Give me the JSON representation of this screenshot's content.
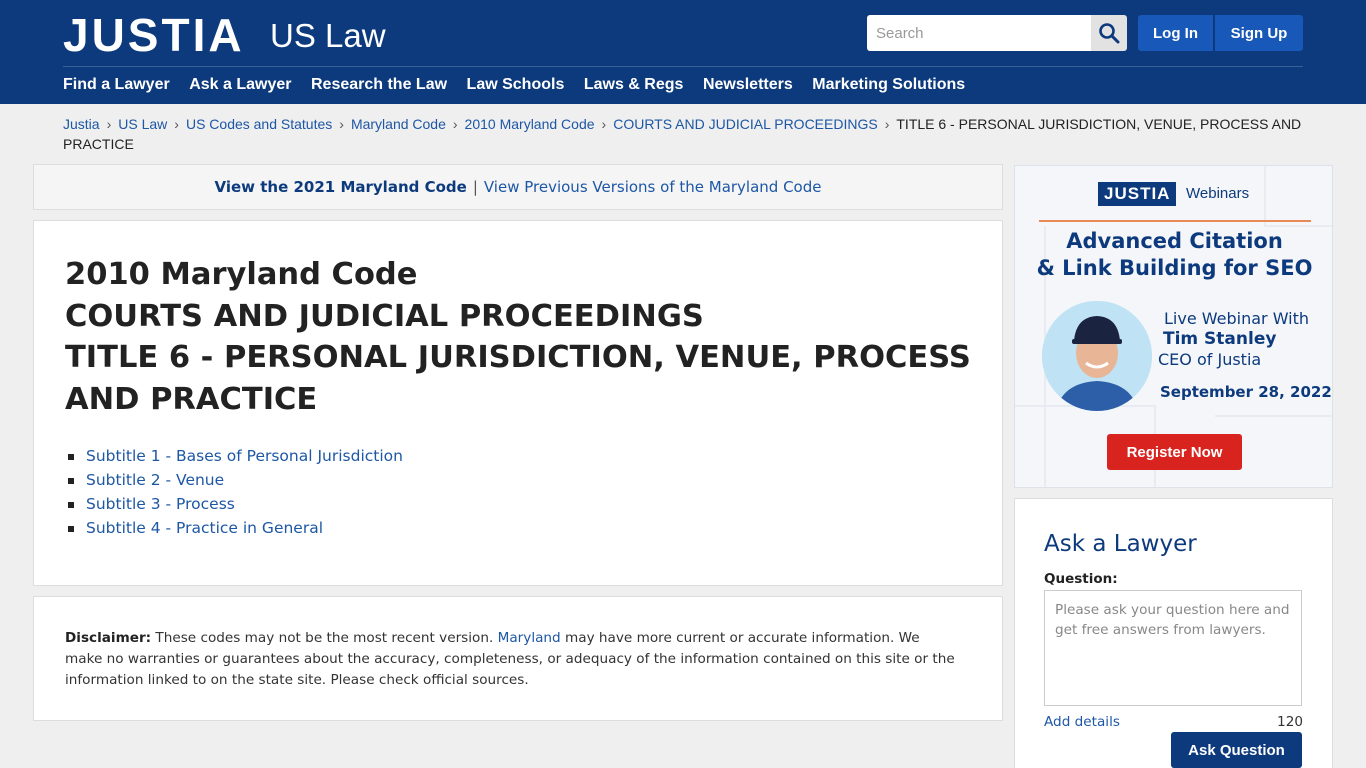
{
  "header": {
    "logo": "JUSTIA",
    "logo_sub": "US Law",
    "search_placeholder": "Search",
    "login": "Log In",
    "signup": "Sign Up",
    "nav": [
      "Find a Lawyer",
      "Ask a Lawyer",
      "Research the Law",
      "Law Schools",
      "Laws & Regs",
      "Newsletters",
      "Marketing Solutions"
    ]
  },
  "breadcrumb": {
    "links": [
      "Justia",
      "US Law",
      "US Codes and Statutes",
      "Maryland Code",
      "2010 Maryland Code",
      "COURTS AND JUDICIAL PROCEEDINGS"
    ],
    "current": "TITLE 6 - PERSONAL JURISDICTION, VENUE, PROCESS AND PRACTICE"
  },
  "version_bar": {
    "current": "View the 2021 Maryland Code",
    "separator": "|",
    "previous": "View Previous Versions of the Maryland Code"
  },
  "main": {
    "title_line1": "2010 Maryland Code",
    "title_line2": "COURTS AND JUDICIAL PROCEEDINGS",
    "title_line3": "TITLE 6 - PERSONAL JURISDICTION, VENUE, PROCESS AND PRACTICE",
    "subtitles": [
      "Subtitle 1 - Bases of Personal Jurisdiction",
      "Subtitle 2 - Venue",
      "Subtitle 3 - Process",
      "Subtitle 4 - Practice in General"
    ]
  },
  "disclaimer": {
    "label": "Disclaimer:",
    "text_before": " These codes may not be the most recent version. ",
    "link": "Maryland",
    "text_after": " may have more current or accurate information. We make no warranties or guarantees about the accuracy, completeness, or adequacy of the information contained on this site or the information linked to on the state site. Please check official sources."
  },
  "ad": {
    "brand": "JUSTIA",
    "product": "Webinars",
    "headline_line1": "Advanced Citation",
    "headline_line2": "& Link Building for SEO",
    "live": "Live Webinar With",
    "speaker": "Tim Stanley",
    "role": "CEO of Justia",
    "date": "September 28, 2022",
    "cta": "Register Now"
  },
  "ask": {
    "title": "Ask a Lawyer",
    "question_label": "Question:",
    "placeholder": "Please ask your question here and get free answers from lawyers.",
    "add_details": "Add details",
    "char_count": "120",
    "button": "Ask Question"
  },
  "colors": {
    "header_bg": "#0d3a7d",
    "button_blue": "#1858b8",
    "link_blue": "#1d57a5",
    "register_red": "#d9231e"
  },
  "icons": {
    "search": "magnifier-icon"
  }
}
